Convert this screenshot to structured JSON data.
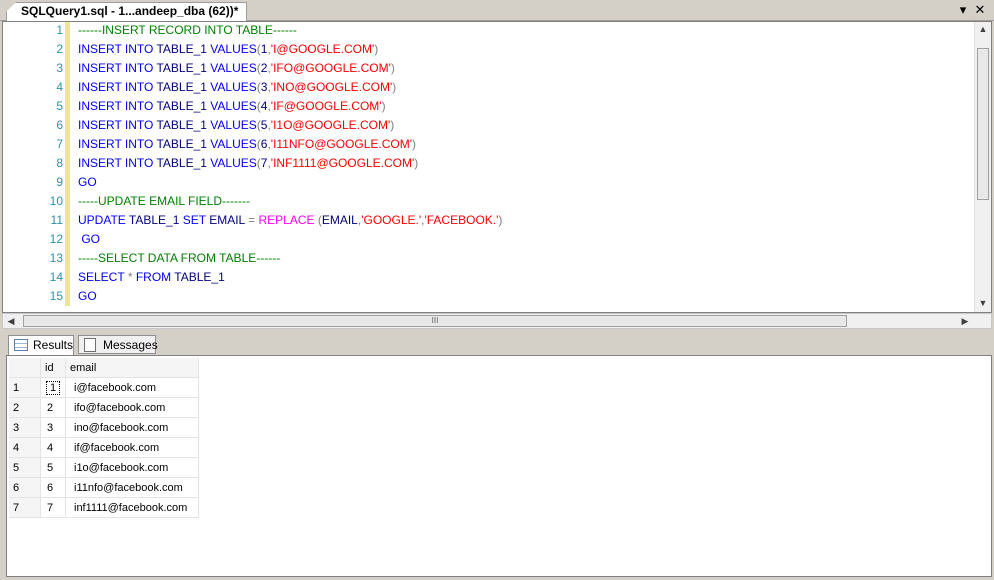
{
  "document_tab": {
    "title": "SQLQuery1.sql - 1...andeep_dba (62))*"
  },
  "window_controls": {
    "dropdown": "▾",
    "close": "✕"
  },
  "editor": {
    "lines": [
      {
        "num": "1",
        "tokens": [
          {
            "t": "------INSERT RECORD INTO TABLE------",
            "c": "cm"
          }
        ]
      },
      {
        "num": "2",
        "tokens": [
          {
            "t": "INSERT INTO",
            "c": "kw"
          },
          {
            "t": " TABLE_1 ",
            "c": "pl"
          },
          {
            "t": "VALUES",
            "c": "kw"
          },
          {
            "t": "(",
            "c": "op"
          },
          {
            "t": "1",
            "c": "pl"
          },
          {
            "t": ",",
            "c": "op"
          },
          {
            "t": "'I@GOOGLE.COM'",
            "c": "str"
          },
          {
            "t": ")",
            "c": "op"
          }
        ]
      },
      {
        "num": "3",
        "tokens": [
          {
            "t": "INSERT INTO",
            "c": "kw"
          },
          {
            "t": " TABLE_1 ",
            "c": "pl"
          },
          {
            "t": "VALUES",
            "c": "kw"
          },
          {
            "t": "(",
            "c": "op"
          },
          {
            "t": "2",
            "c": "pl"
          },
          {
            "t": ",",
            "c": "op"
          },
          {
            "t": "'IFO@GOOGLE.COM'",
            "c": "str"
          },
          {
            "t": ")",
            "c": "op"
          }
        ]
      },
      {
        "num": "4",
        "tokens": [
          {
            "t": "INSERT INTO",
            "c": "kw"
          },
          {
            "t": " TABLE_1 ",
            "c": "pl"
          },
          {
            "t": "VALUES",
            "c": "kw"
          },
          {
            "t": "(",
            "c": "op"
          },
          {
            "t": "3",
            "c": "pl"
          },
          {
            "t": ",",
            "c": "op"
          },
          {
            "t": "'INO@GOOGLE.COM'",
            "c": "str"
          },
          {
            "t": ")",
            "c": "op"
          }
        ]
      },
      {
        "num": "5",
        "tokens": [
          {
            "t": "INSERT INTO",
            "c": "kw"
          },
          {
            "t": " TABLE_1 ",
            "c": "pl"
          },
          {
            "t": "VALUES",
            "c": "kw"
          },
          {
            "t": "(",
            "c": "op"
          },
          {
            "t": "4",
            "c": "pl"
          },
          {
            "t": ",",
            "c": "op"
          },
          {
            "t": "'IF@GOOGLE.COM'",
            "c": "str"
          },
          {
            "t": ")",
            "c": "op"
          }
        ]
      },
      {
        "num": "6",
        "tokens": [
          {
            "t": "INSERT INTO",
            "c": "kw"
          },
          {
            "t": " TABLE_1 ",
            "c": "pl"
          },
          {
            "t": "VALUES",
            "c": "kw"
          },
          {
            "t": "(",
            "c": "op"
          },
          {
            "t": "5",
            "c": "pl"
          },
          {
            "t": ",",
            "c": "op"
          },
          {
            "t": "'I1O@GOOGLE.COM'",
            "c": "str"
          },
          {
            "t": ")",
            "c": "op"
          }
        ]
      },
      {
        "num": "7",
        "tokens": [
          {
            "t": "INSERT INTO",
            "c": "kw"
          },
          {
            "t": " TABLE_1 ",
            "c": "pl"
          },
          {
            "t": "VALUES",
            "c": "kw"
          },
          {
            "t": "(",
            "c": "op"
          },
          {
            "t": "6",
            "c": "pl"
          },
          {
            "t": ",",
            "c": "op"
          },
          {
            "t": "'I11NFO@GOOGLE.COM'",
            "c": "str"
          },
          {
            "t": ")",
            "c": "op"
          }
        ]
      },
      {
        "num": "8",
        "tokens": [
          {
            "t": "INSERT INTO",
            "c": "kw"
          },
          {
            "t": " TABLE_1 ",
            "c": "pl"
          },
          {
            "t": "VALUES",
            "c": "kw"
          },
          {
            "t": "(",
            "c": "op"
          },
          {
            "t": "7",
            "c": "pl"
          },
          {
            "t": ",",
            "c": "op"
          },
          {
            "t": "'INF1111@GOOGLE.COM'",
            "c": "str"
          },
          {
            "t": ")",
            "c": "op"
          }
        ]
      },
      {
        "num": "9",
        "tokens": [
          {
            "t": "GO",
            "c": "kw"
          }
        ]
      },
      {
        "num": "10",
        "tokens": [
          {
            "t": "-----UPDATE EMAIL FIELD-------",
            "c": "cm"
          }
        ]
      },
      {
        "num": "11",
        "tokens": [
          {
            "t": "UPDATE",
            "c": "kw"
          },
          {
            "t": " TABLE_1 ",
            "c": "pl"
          },
          {
            "t": "SET",
            "c": "kw"
          },
          {
            "t": " EMAIL ",
            "c": "pl"
          },
          {
            "t": "=",
            "c": "op"
          },
          {
            "t": " ",
            "c": "pl"
          },
          {
            "t": "REPLACE",
            "c": "fn"
          },
          {
            "t": " (",
            "c": "op"
          },
          {
            "t": "EMAIL",
            "c": "pl"
          },
          {
            "t": ",",
            "c": "op"
          },
          {
            "t": "'GOOGLE.'",
            "c": "str"
          },
          {
            "t": ",",
            "c": "op"
          },
          {
            "t": "'FACEBOOK.'",
            "c": "str"
          },
          {
            "t": ")",
            "c": "op"
          }
        ]
      },
      {
        "num": "12",
        "tokens": [
          {
            "t": " GO",
            "c": "kw"
          }
        ]
      },
      {
        "num": "13",
        "tokens": [
          {
            "t": "-----SELECT DATA FROM TABLE------",
            "c": "cm"
          }
        ]
      },
      {
        "num": "14",
        "tokens": [
          {
            "t": "SELECT",
            "c": "kw"
          },
          {
            "t": " ",
            "c": "pl"
          },
          {
            "t": "*",
            "c": "op"
          },
          {
            "t": " ",
            "c": "pl"
          },
          {
            "t": "FROM",
            "c": "kw"
          },
          {
            "t": " TABLE_1",
            "c": "pl"
          }
        ]
      },
      {
        "num": "15",
        "tokens": [
          {
            "t": "GO",
            "c": "kw"
          }
        ]
      }
    ]
  },
  "hscroll_grip": "III",
  "results_tabs": [
    {
      "label": "Results",
      "icon": "grid-icon",
      "active": true
    },
    {
      "label": "Messages",
      "icon": "messages-icon",
      "active": false
    }
  ],
  "results_grid": {
    "columns": [
      "id",
      "email"
    ],
    "rows": [
      {
        "rownum": "1",
        "id": "1",
        "email": "i@facebook.com"
      },
      {
        "rownum": "2",
        "id": "2",
        "email": "ifo@facebook.com"
      },
      {
        "rownum": "3",
        "id": "3",
        "email": "ino@facebook.com"
      },
      {
        "rownum": "4",
        "id": "4",
        "email": "if@facebook.com"
      },
      {
        "rownum": "5",
        "id": "5",
        "email": "i1o@facebook.com"
      },
      {
        "rownum": "6",
        "id": "6",
        "email": "i11nfo@facebook.com"
      },
      {
        "rownum": "7",
        "id": "7",
        "email": "inf1111@facebook.com"
      }
    ]
  },
  "colors": {
    "keyword": "#0000ff",
    "string": "#ff0000",
    "comment": "#008000",
    "function": "#ff00ff",
    "line_number": "#2b91af"
  }
}
